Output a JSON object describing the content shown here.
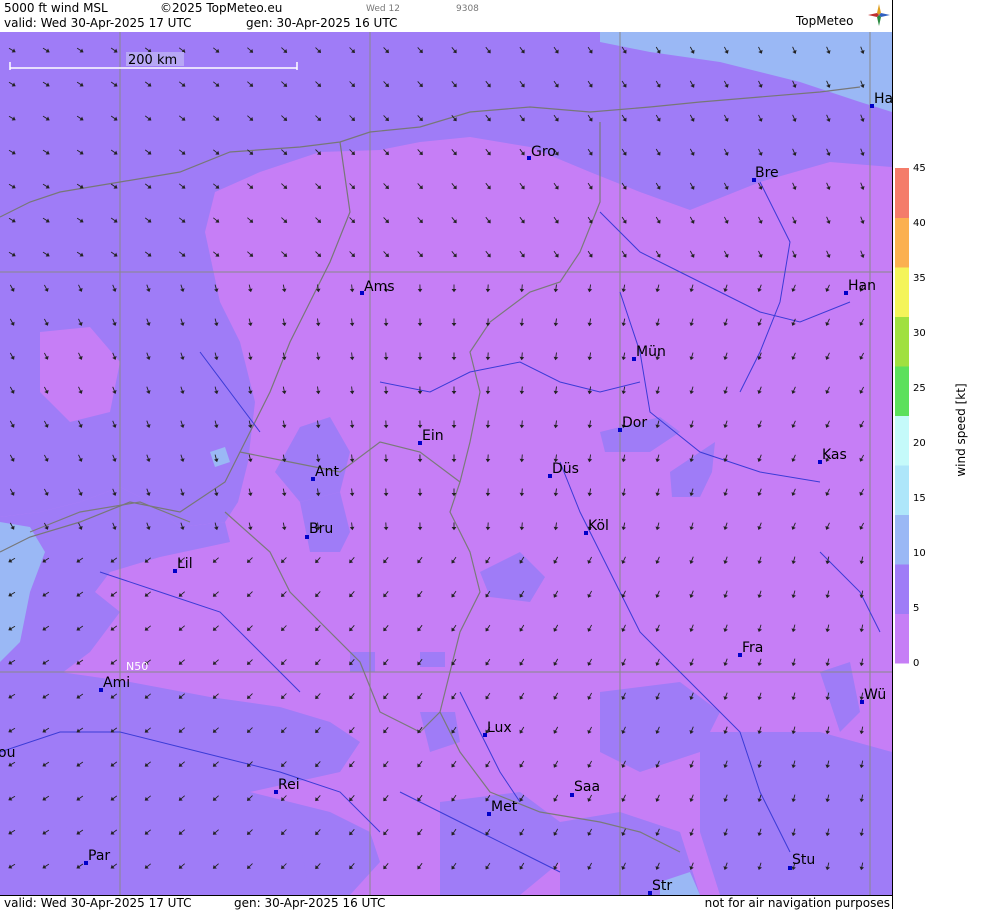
{
  "header": {
    "title": "5000 ft wind MSL",
    "copyright": "©2025 TopMeteo.eu",
    "valid": "valid:  Wed  30-Apr-2025  17 UTC",
    "gen": "gen: 30-Apr-2025 16 UTC",
    "small1": "Wed 12",
    "small2": "9308",
    "logo": "TopMeteo"
  },
  "footer": {
    "valid": "valid:  Wed  30-Apr-2025  17 UTC",
    "gen": "gen: 30-Apr-2025 16 UTC",
    "disclaimer": "not for air navigation purposes"
  },
  "map": {
    "scale_label": "200 km",
    "grid_label": "N50",
    "cities": [
      {
        "label": "Ha"
      },
      {
        "label": "Gro"
      },
      {
        "label": "Bre"
      },
      {
        "label": "Ams"
      },
      {
        "label": "Han"
      },
      {
        "label": "Mün"
      },
      {
        "label": "Ein"
      },
      {
        "label": "Dor"
      },
      {
        "label": "Ant"
      },
      {
        "label": "Düs"
      },
      {
        "label": "Kas"
      },
      {
        "label": "Bru"
      },
      {
        "label": "Köl"
      },
      {
        "label": "Lil"
      },
      {
        "label": "Fra"
      },
      {
        "label": "Ami"
      },
      {
        "label": "Wü"
      },
      {
        "label": "Lux"
      },
      {
        "label": "ou"
      },
      {
        "label": "Rei"
      },
      {
        "label": "Saa"
      },
      {
        "label": "Met"
      },
      {
        "label": "Par"
      },
      {
        "label": "Stu"
      },
      {
        "label": "Str"
      }
    ]
  },
  "legend": {
    "axis_label": "wind  speed  [kt]",
    "ticks": [
      "0",
      "5",
      "10",
      "15",
      "20",
      "25",
      "30",
      "35",
      "40",
      "45"
    ],
    "colors": [
      "#c67ef6",
      "#9f7cf7",
      "#9ab8f5",
      "#aee6fa",
      "#c5fafa",
      "#5ce05c",
      "#a0e040",
      "#f4f45a",
      "#fbb050",
      "#f47c6a"
    ]
  },
  "colors": {
    "band_0_5": "#c67ef6",
    "band_5_10": "#9f7cf7",
    "band_10_15": "#9ab8f5",
    "border": "#888888",
    "river": "#3b3bd6",
    "city_marker": "#0000c8"
  }
}
